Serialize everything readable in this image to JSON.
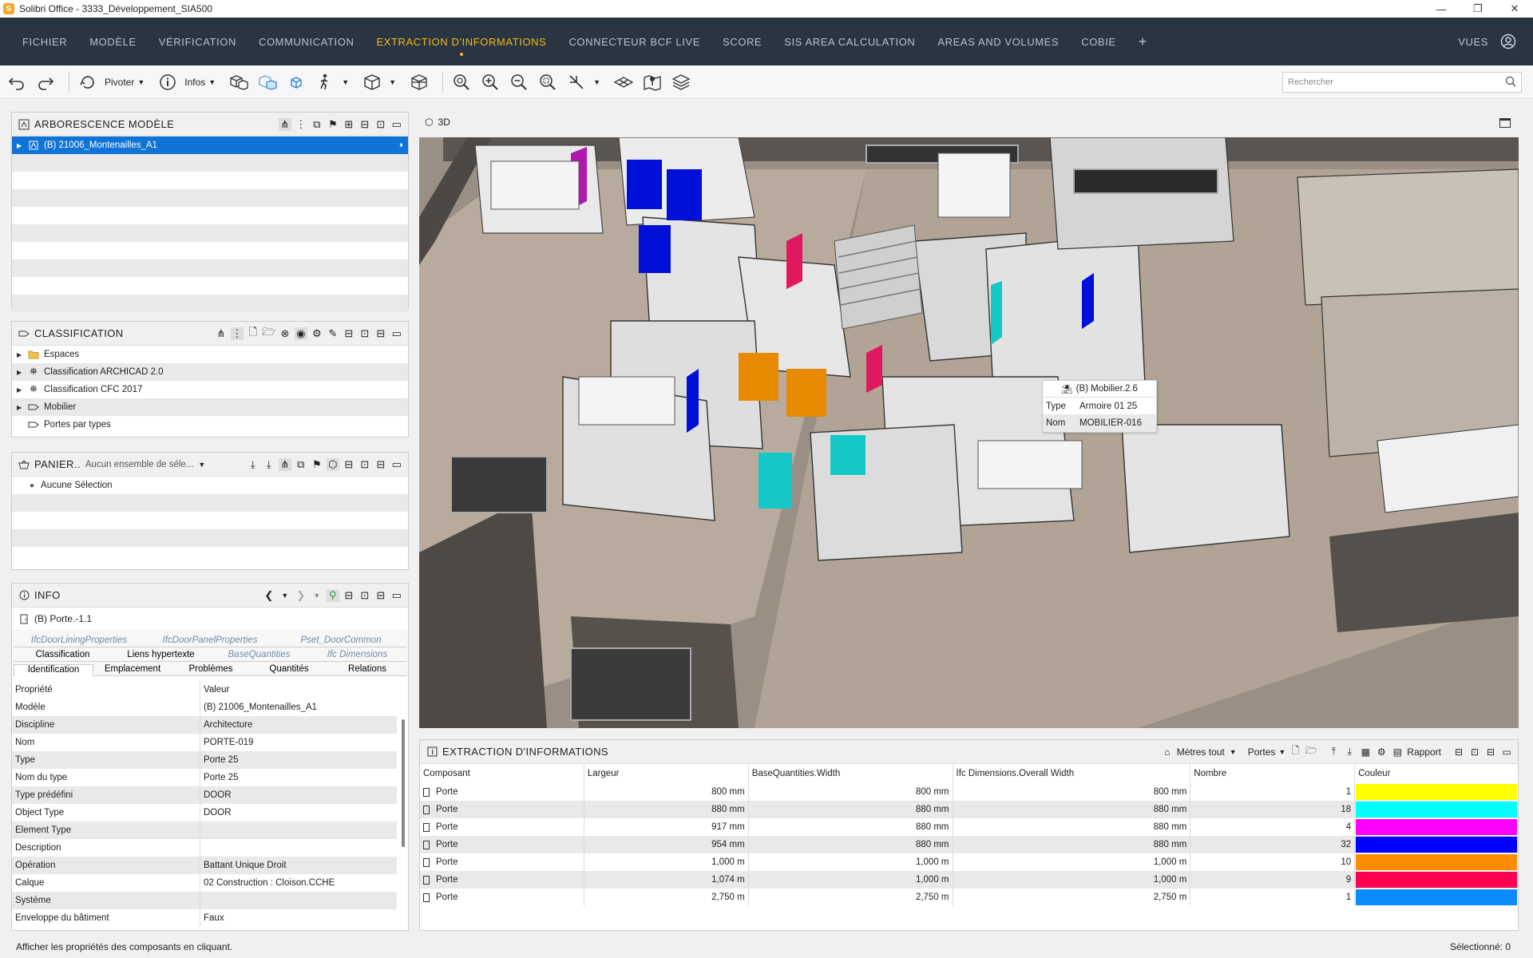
{
  "window": {
    "title": "Solibri Office - 3333_Développement_SIA500",
    "logo": "S",
    "minimize": "—",
    "maximize": "❐",
    "close": "✕"
  },
  "menu": {
    "items": [
      "FICHIER",
      "MODÈLE",
      "VÉRIFICATION",
      "COMMUNICATION",
      "EXTRACTION D'INFORMATIONS",
      "CONNECTEUR BCF LIVE",
      "SCORE",
      "SIS AREA CALCULATION",
      "AREAS AND VOLUMES",
      "COBIE"
    ],
    "active_index": 4,
    "add": "+",
    "views": "VUES",
    "accent": "#f5b915",
    "bg": "#293542"
  },
  "toolbar": {
    "rotate_label": "Pivoter",
    "info_label": "Infos",
    "search_placeholder": "Rechercher"
  },
  "model_tree": {
    "title": "ARBORESCENCE MODÈLE",
    "items": [
      {
        "label": "(B) 21006_Montenailles_A1",
        "selected": true
      }
    ]
  },
  "classification": {
    "title": "CLASSIFICATION",
    "items": [
      {
        "label": "Espaces",
        "icon": "folder-icon"
      },
      {
        "label": "Classification ARCHICAD 2.0",
        "icon": "classification-icon"
      },
      {
        "label": "Classification CFC 2017",
        "icon": "classification-icon"
      },
      {
        "label": "Mobilier",
        "icon": "tag-icon"
      },
      {
        "label": "Portes par types",
        "icon": "tag-icon"
      }
    ]
  },
  "basket": {
    "title": "PANIER..",
    "placeholder": "Aucun ensemble de séle...",
    "empty": "Aucune Sélection"
  },
  "info": {
    "title": "INFO",
    "object": "(B) Porte.-1.1",
    "tabs_row1": [
      "IfcDoorLiningProperties",
      "IfcDoorPanelProperties",
      "Pset_DoorCommon"
    ],
    "tabs_row2": [
      "Classification",
      "Liens hypertexte",
      "BaseQuantities",
      "Ifc Dimensions"
    ],
    "tabs_row3": [
      "Identification",
      "Emplacement",
      "Problèmes",
      "Quantités",
      "Relations"
    ],
    "col_property": "Propriété",
    "col_value": "Valeur",
    "rows": [
      [
        "Modèle",
        "(B) 21006_Montenailles_A1"
      ],
      [
        "Discipline",
        "Architecture"
      ],
      [
        "Nom",
        "PORTE-019"
      ],
      [
        "Type",
        "Porte 25"
      ],
      [
        "Nom du type",
        "Porte 25"
      ],
      [
        "Type prédéfini",
        "DOOR"
      ],
      [
        "Object Type",
        "DOOR"
      ],
      [
        "Element Type",
        ""
      ],
      [
        "Description",
        ""
      ],
      [
        "Opération",
        "Battant Unique Droit"
      ],
      [
        "Calque",
        "02 Construction : Cloison.CCHE"
      ],
      [
        "Système",
        ""
      ],
      [
        "Enveloppe du bâtiment",
        "Faux"
      ]
    ]
  },
  "view3d": {
    "title": "3D",
    "tooltip": {
      "name": "(B) Mobilier.2.6",
      "type_label": "Type",
      "type_value": "Armoire 01 25",
      "name_label": "Nom",
      "name_value": "MOBILIER-016"
    }
  },
  "extraction": {
    "title": "EXTRACTION D'INFORMATIONS",
    "units": "Mètres tout",
    "set": "Portes",
    "report": "Rapport",
    "columns": [
      "Composant",
      "Largeur",
      "BaseQuantities.Width",
      "Ifc Dimensions.Overall Width",
      "Nombre",
      "Couleur"
    ],
    "rows": [
      {
        "c": "Porte",
        "w": "800 mm",
        "bw": "800 mm",
        "ow": "800 mm",
        "n": "1",
        "color": "#ffff00"
      },
      {
        "c": "Porte",
        "w": "880 mm",
        "bw": "880 mm",
        "ow": "880 mm",
        "n": "18",
        "color": "#00ffff"
      },
      {
        "c": "Porte",
        "w": "917 mm",
        "bw": "880 mm",
        "ow": "880 mm",
        "n": "4",
        "color": "#ff00ff"
      },
      {
        "c": "Porte",
        "w": "954 mm",
        "bw": "880 mm",
        "ow": "880 mm",
        "n": "32",
        "color": "#0000ff"
      },
      {
        "c": "Porte",
        "w": "1,000 m",
        "bw": "1,000 m",
        "ow": "1,000 m",
        "n": "10",
        "color": "#ff8c00"
      },
      {
        "c": "Porte",
        "w": "1,074 m",
        "bw": "1,000 m",
        "ow": "1,000 m",
        "n": "9",
        "color": "#ff0050"
      },
      {
        "c": "Porte",
        "w": "2,750 m",
        "bw": "2,750 m",
        "ow": "2,750 m",
        "n": "1",
        "color": "#0a8cff"
      }
    ]
  },
  "status": {
    "left": "Afficher les propriétés des composants en cliquant.",
    "right": "Sélectionné: 0"
  }
}
